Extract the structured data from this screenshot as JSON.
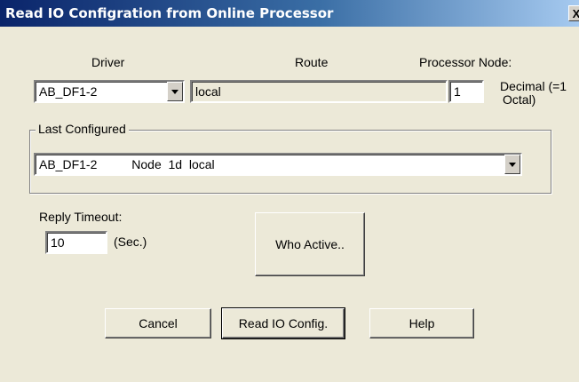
{
  "window": {
    "title": "Read IO Configration from Online Processor",
    "close_glyph": "X"
  },
  "driver": {
    "label": "Driver",
    "value": "AB_DF1-2"
  },
  "route": {
    "label": "Route",
    "value": "local"
  },
  "processor_node": {
    "label": "Processor Node:",
    "value": "1",
    "hint_line1": "Decimal (=1",
    "hint_line2": "Octal)"
  },
  "last_configured": {
    "label": "Last Configured",
    "value": "AB_DF1-2          Node  1d  local"
  },
  "reply_timeout": {
    "label": "Reply Timeout:",
    "value": "10",
    "unit": "(Sec.)"
  },
  "buttons": {
    "who_active": "Who Active..",
    "cancel": "Cancel",
    "read_io_config": "Read IO Config.",
    "help": "Help"
  },
  "icons": {
    "dropdown": "chevron-down-icon",
    "close": "close-icon"
  }
}
